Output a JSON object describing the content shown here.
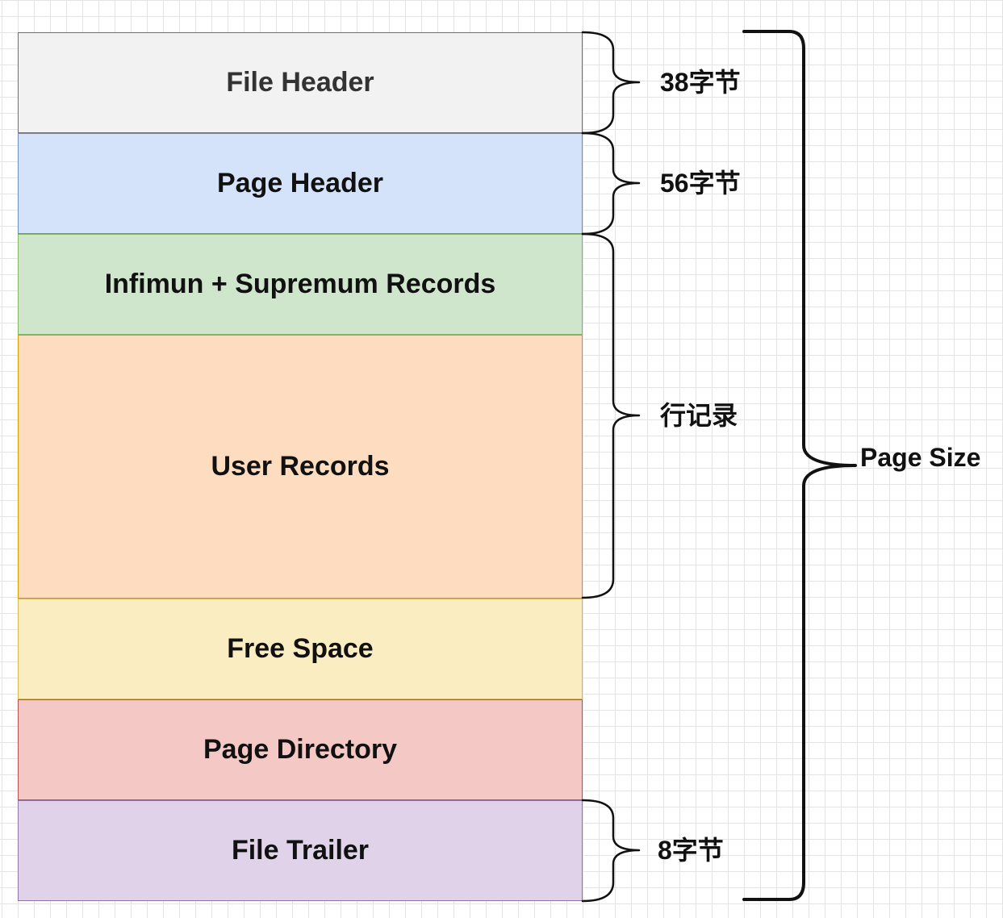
{
  "blocks": [
    {
      "label": "File Header",
      "fill": "#f2f2f2",
      "stroke": "#707070",
      "text_color": "#333333"
    },
    {
      "label": "Page Header",
      "fill": "#d4e2fa",
      "stroke": "#6c8ebf",
      "text_color": "#111111"
    },
    {
      "label": "Infimun + Supremum Records",
      "fill": "#cfe6cc",
      "stroke": "#82b366",
      "text_color": "#111111"
    },
    {
      "label": "User Records",
      "fill": "#fddcbf",
      "stroke": "#d79b00",
      "text_color": "#111111"
    },
    {
      "label": "Free Space",
      "fill": "#fbedc2",
      "stroke": "#d6b656",
      "text_color": "#111111"
    },
    {
      "label": "Page Directory",
      "fill": "#f4c8c5",
      "stroke": "#b85450",
      "text_color": "#111111"
    },
    {
      "label": "File Trailer",
      "fill": "#e0d2e8",
      "stroke": "#9673a6",
      "text_color": "#111111"
    }
  ],
  "annotations": {
    "file_header_size": "38字节",
    "page_header_size": "56字节",
    "row_records": "行记录",
    "file_trailer_size": "8字节",
    "page_size": "Page Size"
  }
}
